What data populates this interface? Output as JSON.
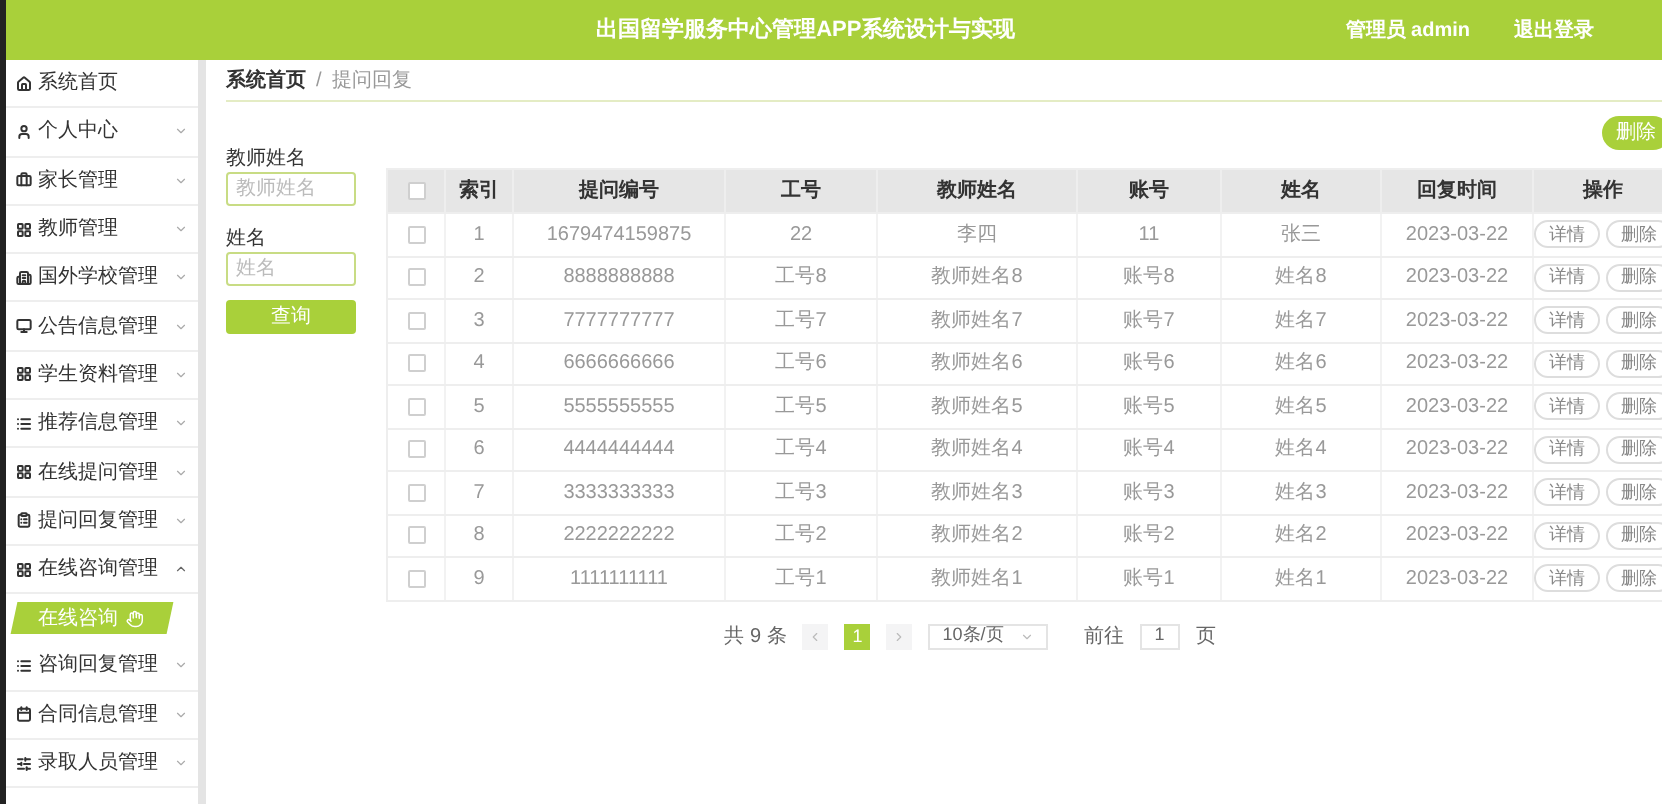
{
  "header": {
    "title": "出国留学服务中心管理APP系统设计与实现",
    "user": "管理员 admin",
    "logout": "退出登录"
  },
  "sidebar": {
    "items": [
      {
        "label": "系统首页",
        "kind": "link"
      },
      {
        "label": "个人中心",
        "kind": "menu",
        "expanded": false
      },
      {
        "label": "家长管理",
        "kind": "menu",
        "expanded": false
      },
      {
        "label": "教师管理",
        "kind": "menu",
        "expanded": false
      },
      {
        "label": "国外学校管理",
        "kind": "menu",
        "expanded": false
      },
      {
        "label": "公告信息管理",
        "kind": "menu",
        "expanded": false
      },
      {
        "label": "学生资料管理",
        "kind": "menu",
        "expanded": false
      },
      {
        "label": "推荐信息管理",
        "kind": "menu",
        "expanded": false
      },
      {
        "label": "在线提问管理",
        "kind": "menu",
        "expanded": false
      },
      {
        "label": "提问回复管理",
        "kind": "menu",
        "expanded": false
      },
      {
        "label": "在线咨询管理",
        "kind": "menu",
        "expanded": true,
        "children": [
          {
            "label": "在线咨询",
            "selected": true
          }
        ]
      },
      {
        "label": "咨询回复管理",
        "kind": "menu",
        "expanded": false
      },
      {
        "label": "合同信息管理",
        "kind": "menu",
        "expanded": false
      },
      {
        "label": "录取人员管理",
        "kind": "menu",
        "expanded": false
      }
    ]
  },
  "breadcrumb": {
    "separator": "/",
    "items": [
      "系统首页",
      "提问回复"
    ]
  },
  "search": {
    "fields": [
      {
        "label": "教师姓名",
        "placeholder": "教师姓名"
      },
      {
        "label": "姓名",
        "placeholder": "姓名"
      }
    ],
    "button": "查询"
  },
  "toolbar": {
    "delete": "删除"
  },
  "table": {
    "header_checked": false,
    "columns": [
      "索引",
      "提问编号",
      "工号",
      "教师姓名",
      "账号",
      "姓名",
      "回复时间",
      "操作"
    ],
    "rows": [
      {
        "checked": false,
        "cells": [
          "1",
          "1679474159875",
          "22",
          "李四",
          "11",
          "张三",
          "2023-03-22"
        ],
        "actions": [
          "详情",
          "删除"
        ]
      },
      {
        "checked": false,
        "cells": [
          "2",
          "8888888888",
          "工号8",
          "教师姓名8",
          "账号8",
          "姓名8",
          "2023-03-22"
        ],
        "actions": [
          "详情",
          "删除"
        ]
      },
      {
        "checked": false,
        "cells": [
          "3",
          "7777777777",
          "工号7",
          "教师姓名7",
          "账号7",
          "姓名7",
          "2023-03-22"
        ],
        "actions": [
          "详情",
          "删除"
        ]
      },
      {
        "checked": false,
        "cells": [
          "4",
          "6666666666",
          "工号6",
          "教师姓名6",
          "账号6",
          "姓名6",
          "2023-03-22"
        ],
        "actions": [
          "详情",
          "删除"
        ]
      },
      {
        "checked": false,
        "cells": [
          "5",
          "5555555555",
          "工号5",
          "教师姓名5",
          "账号5",
          "姓名5",
          "2023-03-22"
        ],
        "actions": [
          "详情",
          "删除"
        ]
      },
      {
        "checked": false,
        "cells": [
          "6",
          "4444444444",
          "工号4",
          "教师姓名4",
          "账号4",
          "姓名4",
          "2023-03-22"
        ],
        "actions": [
          "详情",
          "删除"
        ]
      },
      {
        "checked": false,
        "cells": [
          "7",
          "3333333333",
          "工号3",
          "教师姓名3",
          "账号3",
          "姓名3",
          "2023-03-22"
        ],
        "actions": [
          "详情",
          "删除"
        ]
      },
      {
        "checked": false,
        "cells": [
          "8",
          "2222222222",
          "工号2",
          "教师姓名2",
          "账号2",
          "姓名2",
          "2023-03-22"
        ],
        "actions": [
          "详情",
          "删除"
        ]
      },
      {
        "checked": false,
        "cells": [
          "9",
          "1111111111",
          "工号1",
          "教师姓名1",
          "账号1",
          "姓名1",
          "2023-03-22"
        ],
        "actions": [
          "详情",
          "删除"
        ]
      }
    ]
  },
  "pagination": {
    "total": "共 9 条",
    "pages": [
      {
        "label": "1",
        "selected": true
      }
    ],
    "page_size": "10条/页",
    "goto_label": "前往",
    "goto_value": "1",
    "page_suffix": "页"
  }
}
